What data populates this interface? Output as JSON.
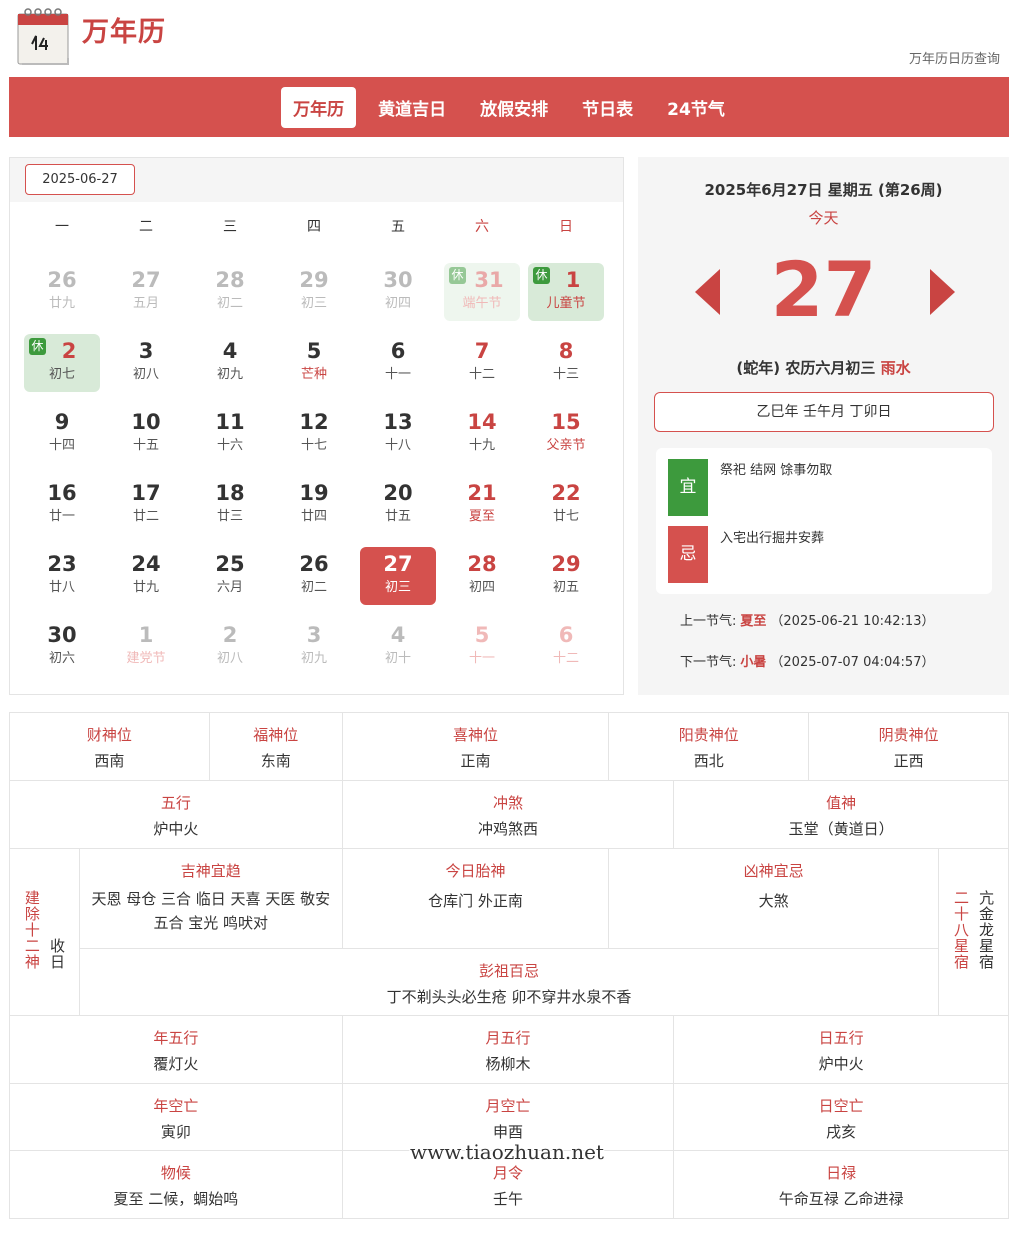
{
  "header": {
    "logo_icon": "calendar-page-icon",
    "site_name": "万年历",
    "subtitle": "万年历日历查询"
  },
  "nav": {
    "items": [
      {
        "label": "万年历",
        "active": true
      },
      {
        "label": "黄道吉日"
      },
      {
        "label": "放假安排"
      },
      {
        "label": "节日表"
      },
      {
        "label": "24节气"
      }
    ]
  },
  "calendar": {
    "date_input": "2025-06-27",
    "weekdays": [
      "一",
      "二",
      "三",
      "四",
      "五",
      "六",
      "日"
    ],
    "rows": [
      [
        {
          "day": "26",
          "lunar": "廿九",
          "other": true
        },
        {
          "day": "27",
          "lunar": "五月",
          "other": true
        },
        {
          "day": "28",
          "lunar": "初二",
          "other": true
        },
        {
          "day": "29",
          "lunar": "初三",
          "other": true
        },
        {
          "day": "30",
          "lunar": "初四",
          "other": true
        },
        {
          "day": "31",
          "lunar": "端午节",
          "other": true,
          "weekend": true,
          "festival": true,
          "holiday": true,
          "rest": "休"
        },
        {
          "day": "1",
          "lunar": "儿童节",
          "weekend": true,
          "festival": true,
          "holiday": true,
          "rest": "休"
        }
      ],
      [
        {
          "day": "2",
          "lunar": "初七",
          "holiday": true,
          "rest": "休",
          "weekend": true
        },
        {
          "day": "3",
          "lunar": "初八"
        },
        {
          "day": "4",
          "lunar": "初九"
        },
        {
          "day": "5",
          "lunar": "芒种",
          "festival": true
        },
        {
          "day": "6",
          "lunar": "十一"
        },
        {
          "day": "7",
          "lunar": "十二",
          "weekend": true
        },
        {
          "day": "8",
          "lunar": "十三",
          "weekend": true
        }
      ],
      [
        {
          "day": "9",
          "lunar": "十四"
        },
        {
          "day": "10",
          "lunar": "十五"
        },
        {
          "day": "11",
          "lunar": "十六"
        },
        {
          "day": "12",
          "lunar": "十七"
        },
        {
          "day": "13",
          "lunar": "十八"
        },
        {
          "day": "14",
          "lunar": "十九",
          "weekend": true
        },
        {
          "day": "15",
          "lunar": "父亲节",
          "weekend": true,
          "festival": true
        }
      ],
      [
        {
          "day": "16",
          "lunar": "廿一"
        },
        {
          "day": "17",
          "lunar": "廿二"
        },
        {
          "day": "18",
          "lunar": "廿三"
        },
        {
          "day": "19",
          "lunar": "廿四"
        },
        {
          "day": "20",
          "lunar": "廿五"
        },
        {
          "day": "21",
          "lunar": "夏至",
          "weekend": true,
          "festival": true
        },
        {
          "day": "22",
          "lunar": "廿七",
          "weekend": true
        }
      ],
      [
        {
          "day": "23",
          "lunar": "廿八"
        },
        {
          "day": "24",
          "lunar": "廿九"
        },
        {
          "day": "25",
          "lunar": "六月"
        },
        {
          "day": "26",
          "lunar": "初二"
        },
        {
          "day": "27",
          "lunar": "初三",
          "today": true
        },
        {
          "day": "28",
          "lunar": "初四",
          "weekend": true
        },
        {
          "day": "29",
          "lunar": "初五",
          "weekend": true
        }
      ],
      [
        {
          "day": "30",
          "lunar": "初六"
        },
        {
          "day": "1",
          "lunar": "建党节",
          "other": true,
          "festival": true
        },
        {
          "day": "2",
          "lunar": "初八",
          "other": true
        },
        {
          "day": "3",
          "lunar": "初九",
          "other": true
        },
        {
          "day": "4",
          "lunar": "初十",
          "other": true
        },
        {
          "day": "5",
          "lunar": "十一",
          "other": true,
          "weekend": true
        },
        {
          "day": "6",
          "lunar": "十二",
          "other": true,
          "weekend": true
        }
      ]
    ]
  },
  "detail": {
    "full_date": "2025年6月27日 星期五 (第26周)",
    "today_label": "今天",
    "big_day": "27",
    "lunar_prefix": "(蛇年) 农历六月初三",
    "solar_term": "雨水",
    "ganzhi": "乙巳年 壬午月 丁卯日",
    "yi_label": "宜",
    "yi_text": "祭祀 结网 馀事勿取",
    "ji_label": "忌",
    "ji_text": "入宅出行掘井安葬",
    "prev_term_label": "上一节气:",
    "prev_term_name": "夏至",
    "prev_term_time": "（2025-06-21 10:42:13）",
    "next_term_label": "下一节气:",
    "next_term_name": "小暑",
    "next_term_time": "（2025-07-07 04:04:57）"
  },
  "info": {
    "caishen_label": "财神位",
    "caishen": "西南",
    "fushen_label": "福神位",
    "fushen": "东南",
    "xishen_label": "喜神位",
    "xishen": "正南",
    "yanggui_label": "阳贵神位",
    "yanggui": "西北",
    "yingui_label": "阴贵神位",
    "yingui": "正西",
    "wuxing_label": "五行",
    "wuxing": "炉中火",
    "chongsha_label": "冲煞",
    "chongsha": "冲鸡煞西",
    "zhishen_label": "值神",
    "zhishen": "玉堂（黄道日）",
    "jianchu_label": "建除十二神",
    "jianchu": "收日",
    "jishen_label": "吉神宜趋",
    "jishen": "天恩 母仓 三合 临日 天喜 天医 敬安 五合 宝光 鸣吠对",
    "taishen_label": "今日胎神",
    "taishen": "仓库门 外正南",
    "xiongshen_label": "凶神宜忌",
    "xiongshen": "大煞",
    "xiuxing_label": "二十八星宿",
    "xiuxing": "亢金龙星宿",
    "pengzu_label": "彭祖百忌",
    "pengzu": "丁不剃头头必生疮 卯不穿井水泉不香",
    "nianwx_label": "年五行",
    "nianwx": "覆灯火",
    "yuewx_label": "月五行",
    "yuewx": "杨柳木",
    "riwx_label": "日五行",
    "riwx": "炉中火",
    "niankw_label": "年空亡",
    "niankw": "寅卯",
    "yuekw_label": "月空亡",
    "yuekw": "申酉",
    "rikw_label": "日空亡",
    "rikw": "戌亥",
    "wuhou_label": "物候",
    "wuhou": "夏至 二候，蜩始鸣",
    "yueling_label": "月令",
    "yueling": "壬午",
    "rilu_label": "日禄",
    "rilu": "午命互禄 乙命进禄"
  },
  "watermark": "www.tiaozhuan.net",
  "colors": {
    "accent": "#d5514e",
    "accent_text": "#c94442",
    "yi_green": "#3d9a3d",
    "holiday_bg": "#d8ead8",
    "panel_bg": "#f5f5f5"
  }
}
